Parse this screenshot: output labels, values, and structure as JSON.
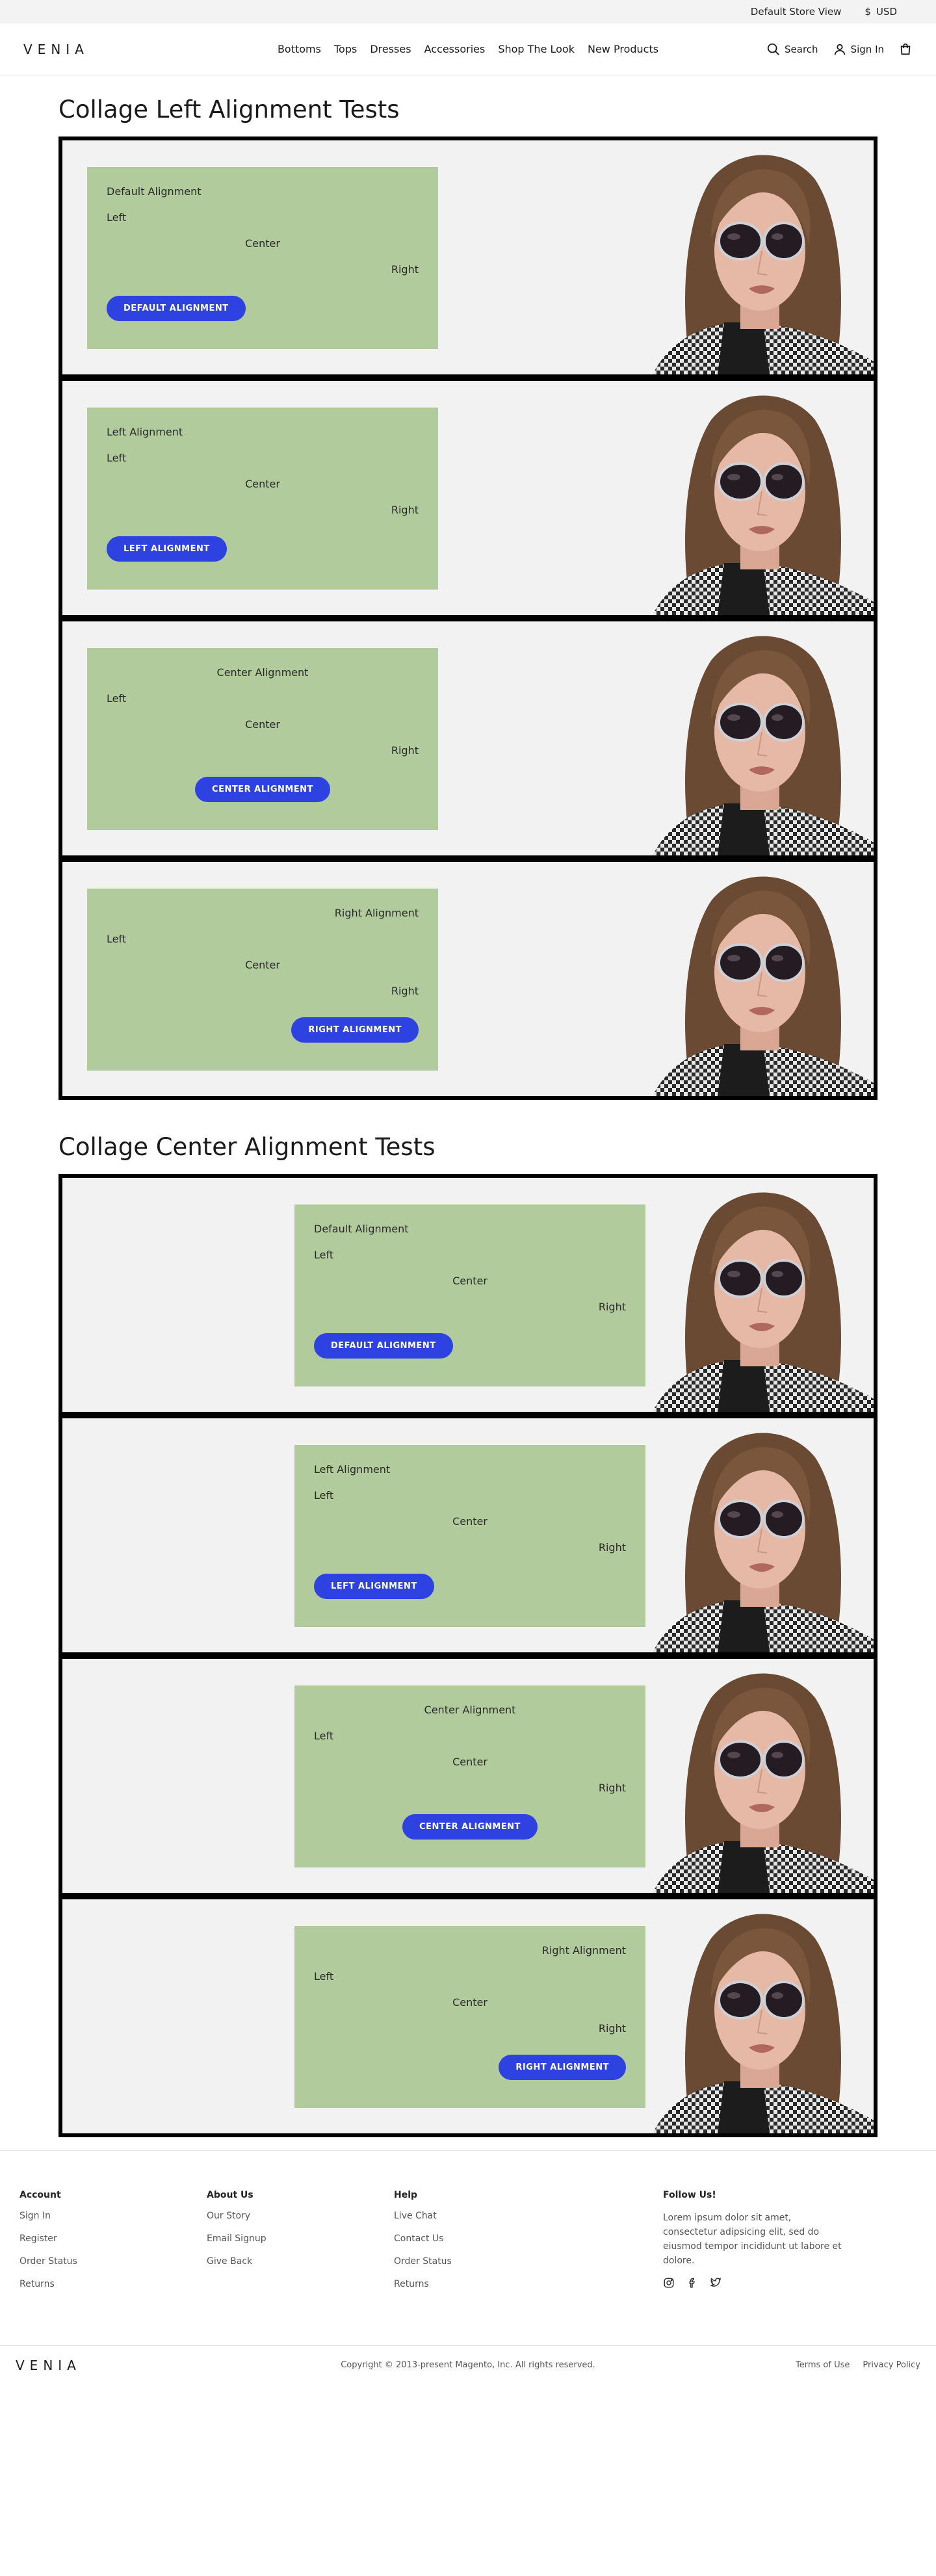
{
  "topbar": {
    "store": "Default Store View",
    "currency_symbol": "$",
    "currency": "USD"
  },
  "header": {
    "logo": "VENIA",
    "nav": [
      "Bottoms",
      "Tops",
      "Dresses",
      "Accessories",
      "Shop The Look",
      "New Products"
    ],
    "search": "Search",
    "signin": "Sign In"
  },
  "sections": [
    {
      "title": "Collage Left Alignment Tests",
      "rows": [
        {
          "heading": "Default Alignment",
          "left": "Left",
          "center": "Center",
          "right": "Right",
          "button": "DEFAULT ALIGNMENT"
        },
        {
          "heading": "Left Alignment",
          "left": "Left",
          "center": "Center",
          "right": "Right",
          "button": "LEFT ALIGNMENT"
        },
        {
          "heading": "Center Alignment",
          "left": "Left",
          "center": "Center",
          "right": "Right",
          "button": "CENTER ALIGNMENT"
        },
        {
          "heading": "Right Alignment",
          "left": "Left",
          "center": "Center",
          "right": "Right",
          "button": "RIGHT ALIGNMENT"
        }
      ]
    },
    {
      "title": "Collage Center Alignment Tests",
      "rows": [
        {
          "heading": "Default Alignment",
          "left": "Left",
          "center": "Center",
          "right": "Right",
          "button": "DEFAULT ALIGNMENT"
        },
        {
          "heading": "Left Alignment",
          "left": "Left",
          "center": "Center",
          "right": "Right",
          "button": "LEFT ALIGNMENT"
        },
        {
          "heading": "Center Alignment",
          "left": "Left",
          "center": "Center",
          "right": "Right",
          "button": "CENTER ALIGNMENT"
        },
        {
          "heading": "Right Alignment",
          "left": "Left",
          "center": "Center",
          "right": "Right",
          "button": "RIGHT ALIGNMENT"
        }
      ]
    }
  ],
  "footer": {
    "account": {
      "title": "Account",
      "items": [
        "Sign In",
        "Register",
        "Order Status",
        "Returns"
      ]
    },
    "about": {
      "title": "About Us",
      "items": [
        "Our Story",
        "Email Signup",
        "Give Back"
      ]
    },
    "help": {
      "title": "Help",
      "items": [
        "Live Chat",
        "Contact Us",
        "Order Status",
        "Returns"
      ]
    },
    "follow": {
      "title": "Follow Us!",
      "text": "Lorem ipsum dolor sit amet, consectetur adipsicing elit, sed do eiusmod tempor incididunt ut labore et dolore."
    },
    "copyright": "Copyright © 2013-present Magento, Inc. All rights reserved.",
    "links": [
      "Terms of Use",
      "Privacy Policy"
    ],
    "logo": "VENIA"
  },
  "icons": [
    "search-icon",
    "user-icon",
    "cart-icon",
    "instagram-icon",
    "facebook-icon",
    "twitter-icon"
  ],
  "colors": {
    "panel": "#b2cb9c",
    "button": "#2d42e0",
    "row_bg": "#f2f2f2"
  }
}
